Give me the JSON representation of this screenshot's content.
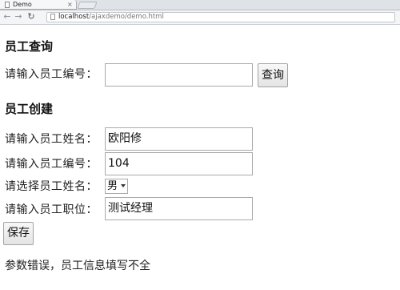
{
  "browser": {
    "tab_title": "Demo",
    "tab_close": "×",
    "url_host": "localhost",
    "url_path": "/ajaxdemo/demo.html"
  },
  "query": {
    "title": "员工查询",
    "id_label": "请输入员工编号：",
    "id_value": "",
    "search_button": "查询"
  },
  "create": {
    "title": "员工创建",
    "name_label": "请输入员工姓名：",
    "name_value": "欧阳修",
    "id_label": "请输入员工编号：",
    "id_value": "104",
    "gender_label": "请选择员工姓名：",
    "gender_value": "男",
    "position_label": "请输入员工职位：",
    "position_value": "测试经理",
    "save_button": "保存"
  },
  "message": "参数错误，员工信息填写不全"
}
